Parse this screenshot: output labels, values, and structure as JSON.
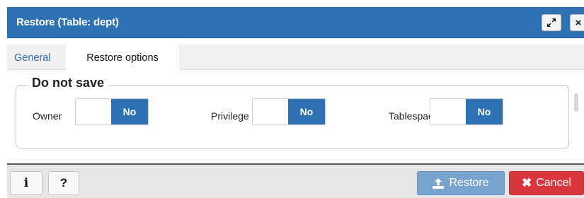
{
  "dialog": {
    "title": "Restore (Table: dept)",
    "accent_color": "#2f72b4"
  },
  "titlebar": {
    "maximize_icon": "maximize-icon",
    "close_glyph": "×"
  },
  "tabs": [
    {
      "label": "General",
      "active": false
    },
    {
      "label": "Restore options",
      "active": true
    }
  ],
  "section": {
    "legend": "Do not save",
    "fields": [
      {
        "label": "Owner",
        "value": "No"
      },
      {
        "label": "Privilege",
        "value": "No"
      },
      {
        "label": "Tablespace",
        "value": "No"
      }
    ]
  },
  "footer": {
    "info_glyph": "i",
    "help_glyph": "?",
    "restore_label": "Restore",
    "cancel_label": "Cancel",
    "cancel_glyph": "✖",
    "restore_color": "#79a3cf",
    "cancel_color": "#d9363e"
  }
}
